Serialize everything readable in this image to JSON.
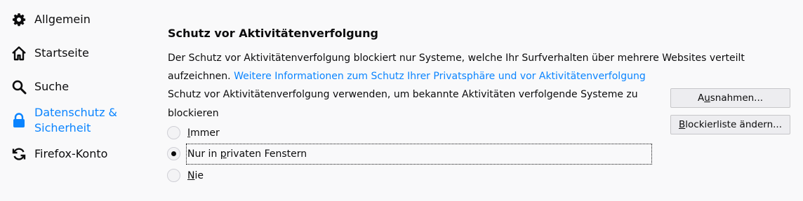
{
  "sidebar": {
    "items": [
      {
        "label": "Allgemein",
        "icon": "gear-icon"
      },
      {
        "label": "Startseite",
        "icon": "home-icon"
      },
      {
        "label": "Suche",
        "icon": "search-icon"
      },
      {
        "label_line1": "Datenschutz &",
        "label_line2": "Sicherheit",
        "icon": "lock-icon",
        "selected": true
      },
      {
        "label": "Firefox-Konto",
        "icon": "sync-icon"
      }
    ]
  },
  "tracking": {
    "title": "Schutz vor Aktivitätenverfolgung",
    "description": "Der Schutz vor Aktivitätenverfolgung blockiert nur Systeme, welche Ihr Surfverhalten über mehrere Websites verteilt aufzeichnen.",
    "learn_more_link": "Weitere Informationen zum Schutz Ihrer Privatsphäre und vor Aktivitätenverfolgung",
    "prompt": "Schutz vor Aktivitätenverfolgung verwenden, um bekannte Aktivitäten verfolgende Systeme zu blockieren",
    "options": [
      {
        "pre": "",
        "u": "I",
        "post": "mmer",
        "checked": false
      },
      {
        "pre": "Nur in ",
        "u": "p",
        "post": "rivaten Fenstern",
        "checked": true
      },
      {
        "pre": "",
        "u": "N",
        "post": "ie",
        "checked": false
      }
    ],
    "exceptions_button": {
      "pre": "A",
      "u": "u",
      "post": "snahmen..."
    },
    "blocklist_button": {
      "pre": "",
      "u": "B",
      "post": "lockierliste ändern..."
    }
  },
  "colors": {
    "accent": "#0a84ff",
    "background": "#f9f9fa"
  }
}
